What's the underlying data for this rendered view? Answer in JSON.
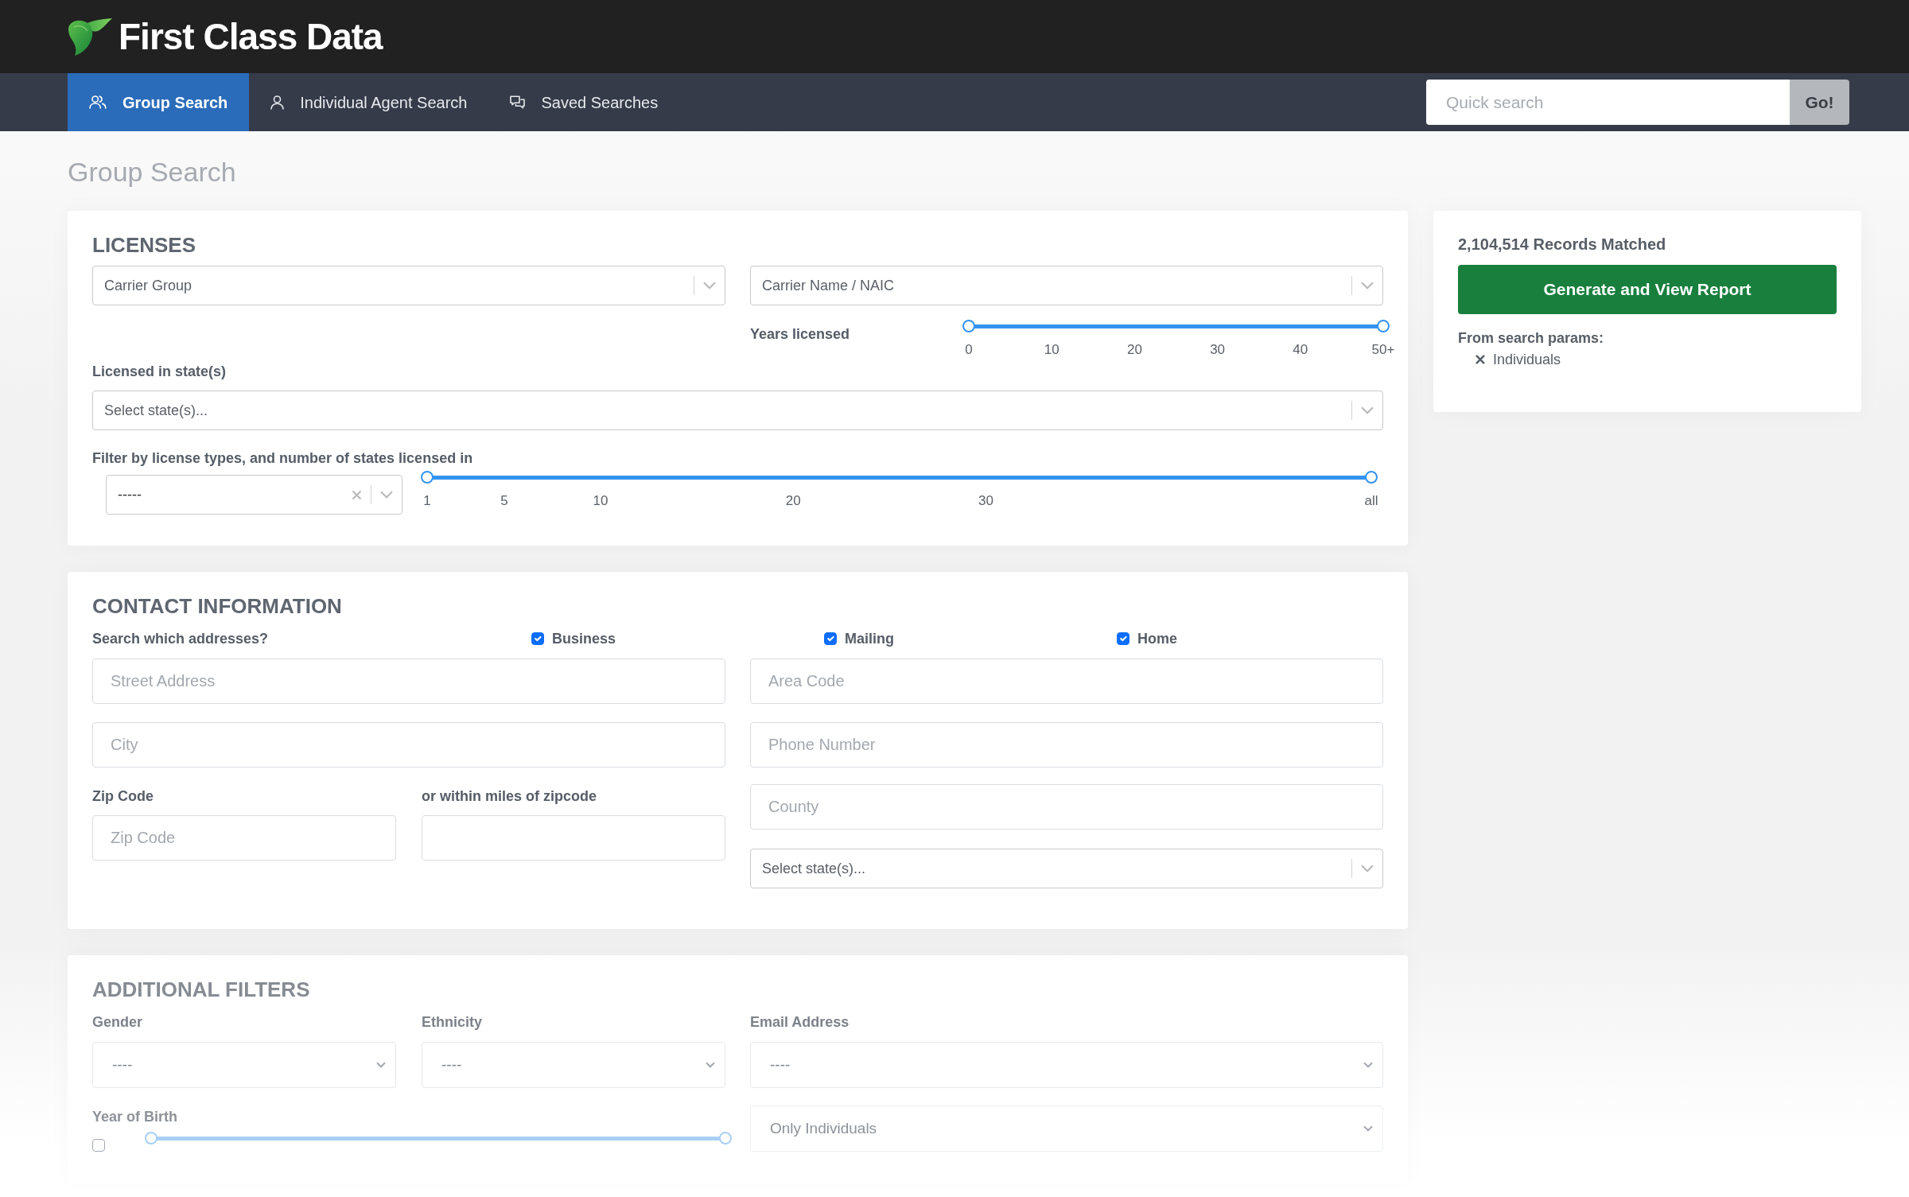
{
  "header": {
    "brand": "First Class Data"
  },
  "nav": {
    "tabs": [
      {
        "label": "Group Search",
        "selected": true
      },
      {
        "label": "Individual Agent Search",
        "selected": false
      },
      {
        "label": "Saved Searches",
        "selected": false
      }
    ],
    "quick_search": {
      "placeholder": "Quick search",
      "button": "Go!"
    }
  },
  "page_title": "Group Search",
  "licenses": {
    "title": "LICENSES",
    "carrier_group": {
      "placeholder": "Carrier Group"
    },
    "carrier_name": {
      "placeholder": "Carrier Name / NAIC"
    },
    "years_licensed": {
      "label": "Years licensed",
      "level": 1,
      "ticks": [
        "0",
        "10",
        "20",
        "30",
        "40",
        "50+"
      ]
    },
    "licensed_states": {
      "label": "Licensed in state(s)",
      "placeholder": "Select state(s)..."
    },
    "license_types": {
      "label": "Filter by license types, and number of states licensed in",
      "value": "-----",
      "states_count": {
        "level": 1,
        "ticks": [
          "1",
          "5",
          "10",
          "20",
          "30",
          "all"
        ]
      }
    }
  },
  "contact": {
    "title": "CONTACT INFORMATION",
    "addresses": {
      "label": "Search which addresses?",
      "options": [
        {
          "label": "Business",
          "checked": true
        },
        {
          "label": "Mailing",
          "checked": true
        },
        {
          "label": "Home",
          "checked": true
        }
      ]
    },
    "street_address": {
      "placeholder": "Street Address"
    },
    "city": {
      "placeholder": "City"
    },
    "zip_code": {
      "label": "Zip Code",
      "placeholder": "Zip Code"
    },
    "zip_radius": {
      "label": "or within miles of zipcode"
    },
    "area_code": {
      "placeholder": "Area Code"
    },
    "phone_number": {
      "placeholder": "Phone Number"
    },
    "county": {
      "placeholder": "County"
    },
    "states": {
      "placeholder": "Select state(s)..."
    }
  },
  "additional_filters": {
    "title": "ADDITIONAL FILTERS",
    "gender": {
      "label": "Gender",
      "value": "----"
    },
    "ethnicity": {
      "label": "Ethnicity",
      "value": "----"
    },
    "email_address": {
      "label": "Email Address",
      "value": "----"
    },
    "year_of_birth": {
      "label": "Year of Birth",
      "checked": false,
      "level": 1
    },
    "individuals": {
      "value": "Only Individuals"
    }
  },
  "summary": {
    "records": "2,104,514 Records Matched",
    "button": "Generate and View Report",
    "params_label": "From search params:",
    "params": [
      "Individuals"
    ]
  }
}
